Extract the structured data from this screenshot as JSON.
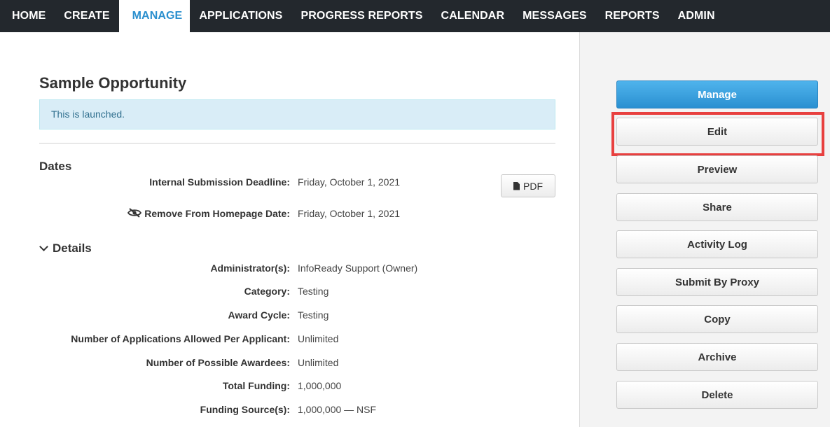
{
  "nav": {
    "items": [
      {
        "label": "HOME",
        "active": false
      },
      {
        "label": "CREATE",
        "active": false
      },
      {
        "label": "MANAGE",
        "active": true
      },
      {
        "label": "APPLICATIONS",
        "active": false
      },
      {
        "label": "PROGRESS REPORTS",
        "active": false
      },
      {
        "label": "CALENDAR",
        "active": false
      },
      {
        "label": "MESSAGES",
        "active": false
      },
      {
        "label": "REPORTS",
        "active": false
      },
      {
        "label": "ADMIN",
        "active": false
      }
    ]
  },
  "page": {
    "title": "Sample Opportunity",
    "alert": "This is launched."
  },
  "dates": {
    "heading": "Dates",
    "pdf_label": "PDF",
    "rows": [
      {
        "label": "Internal Submission Deadline:",
        "value": "Friday, October 1, 2021"
      },
      {
        "label": "Remove From Homepage Date:",
        "value": "Friday, October 1, 2021"
      }
    ]
  },
  "details": {
    "heading": "Details",
    "rows": [
      {
        "label": "Administrator(s):",
        "value": "InfoReady Support (Owner)"
      },
      {
        "label": "Category:",
        "value": "Testing"
      },
      {
        "label": "Award Cycle:",
        "value": "Testing"
      },
      {
        "label": "Number of Applications Allowed Per Applicant:",
        "value": "Unlimited"
      },
      {
        "label": "Number of Possible Awardees:",
        "value": "Unlimited"
      },
      {
        "label": "Total Funding:",
        "value": "1,000,000"
      },
      {
        "label": "Funding Source(s):",
        "value": "1,000,000 — NSF"
      }
    ]
  },
  "sidebar": {
    "buttons": [
      {
        "label": "Manage"
      },
      {
        "label": "Edit"
      },
      {
        "label": "Preview"
      },
      {
        "label": "Share"
      },
      {
        "label": "Activity Log"
      },
      {
        "label": "Submit By Proxy"
      },
      {
        "label": "Copy"
      },
      {
        "label": "Archive"
      },
      {
        "label": "Delete"
      }
    ]
  },
  "colors": {
    "nav_bg": "#23282d",
    "nav_active_text": "#2a8fce",
    "primary_button": "#2a90d1",
    "alert_bg": "#d9edf7",
    "highlight": "#e8403f"
  }
}
